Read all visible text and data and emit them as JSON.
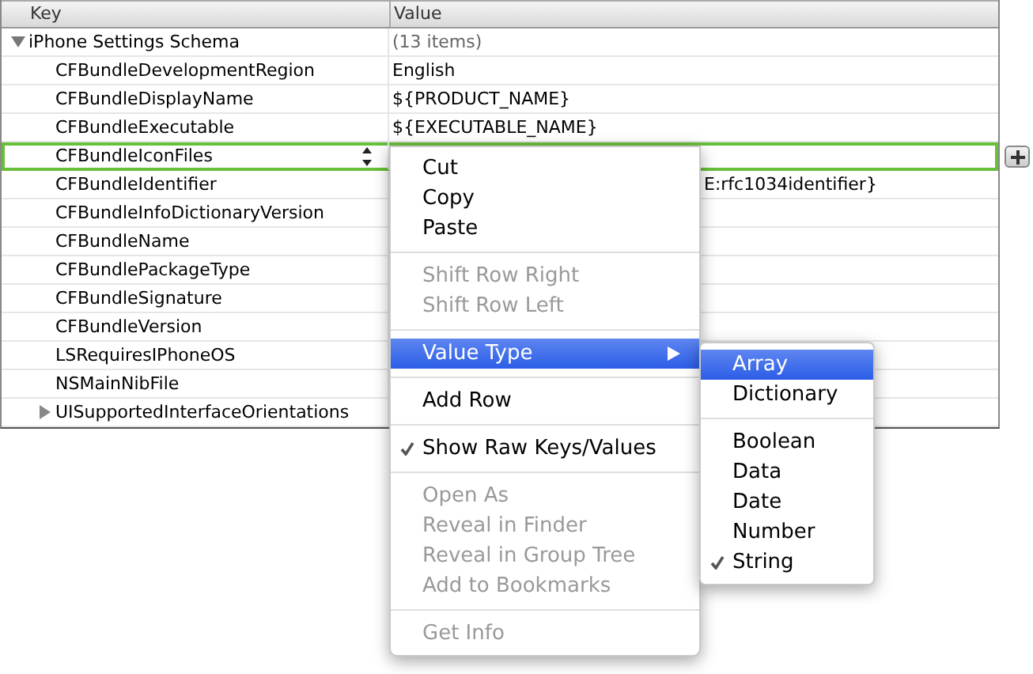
{
  "columns": [
    "Key",
    "Value"
  ],
  "rows": [
    {
      "key": "iPhone Settings Schema",
      "value": "(13 items)",
      "expanded": true,
      "selected": false,
      "children": [
        {
          "key": "CFBundleDevelopmentRegion",
          "value": "English",
          "selected": false
        },
        {
          "key": "CFBundleDisplayName",
          "value": "${PRODUCT_NAME}",
          "selected": false
        },
        {
          "key": "CFBundleExecutable",
          "value": "${EXECUTABLE_NAME}",
          "selected": false
        },
        {
          "key": "CFBundleIconFiles",
          "selected": true
        },
        {
          "key": "CFBundleIdentifier",
          "value": "E:rfc1034identifier}",
          "kind": "covered",
          "selected": false
        },
        {
          "key": "CFBundleInfoDictionaryVersion",
          "selected": false
        },
        {
          "key": "CFBundleName",
          "selected": false
        },
        {
          "key": "CFBundlePackageType",
          "selected": false
        },
        {
          "key": "CFBundleSignature",
          "selected": false
        },
        {
          "key": "CFBundleVersion",
          "selected": false
        },
        {
          "key": "LSRequiresIPhoneOS",
          "selected": false
        },
        {
          "key": "NSMainNibFile",
          "selected": false
        },
        {
          "key": "UISupportedInterfaceOrientations",
          "expanded": false,
          "selected": false
        }
      ]
    }
  ],
  "menu": [
    {
      "kind": "item",
      "label": "Cut",
      "disabled": false
    },
    {
      "kind": "item",
      "label": "Copy",
      "disabled": false
    },
    {
      "kind": "item",
      "label": "Paste",
      "disabled": false
    },
    {
      "kind": "separator"
    },
    {
      "kind": "item",
      "label": "Shift Row Right",
      "disabled": true
    },
    {
      "kind": "item",
      "label": "Shift Row Left",
      "disabled": true
    },
    {
      "kind": "separator"
    },
    {
      "kind": "item",
      "label": "Value Type",
      "disabled": false,
      "selected": true,
      "submenu": true
    },
    {
      "kind": "separator"
    },
    {
      "kind": "item",
      "label": "Add Row",
      "disabled": false
    },
    {
      "kind": "separator"
    },
    {
      "kind": "item",
      "label": "Show Raw Keys/Values",
      "disabled": false,
      "checked": true
    },
    {
      "kind": "separator"
    },
    {
      "kind": "item",
      "label": "Open As",
      "disabled": true
    },
    {
      "kind": "item",
      "label": "Reveal in Finder",
      "disabled": true
    },
    {
      "kind": "item",
      "label": "Reveal in Group Tree",
      "disabled": true
    },
    {
      "kind": "item",
      "label": "Add to Bookmarks",
      "disabled": true
    },
    {
      "kind": "separator"
    },
    {
      "kind": "item",
      "label": "Get Info",
      "disabled": true
    }
  ],
  "submenu": [
    {
      "kind": "item",
      "label": "Array",
      "selected": true,
      "checked": false
    },
    {
      "kind": "item",
      "label": "Dictionary",
      "selected": false,
      "checked": false
    },
    {
      "kind": "separator"
    },
    {
      "kind": "item",
      "label": "Boolean",
      "selected": false,
      "checked": false
    },
    {
      "kind": "item",
      "label": "Data",
      "selected": false,
      "checked": false
    },
    {
      "kind": "item",
      "label": "Date",
      "selected": false,
      "checked": false
    },
    {
      "kind": "item",
      "label": "Number",
      "selected": false,
      "checked": false
    },
    {
      "kind": "item",
      "label": "String",
      "selected": false,
      "checked": true
    }
  ]
}
